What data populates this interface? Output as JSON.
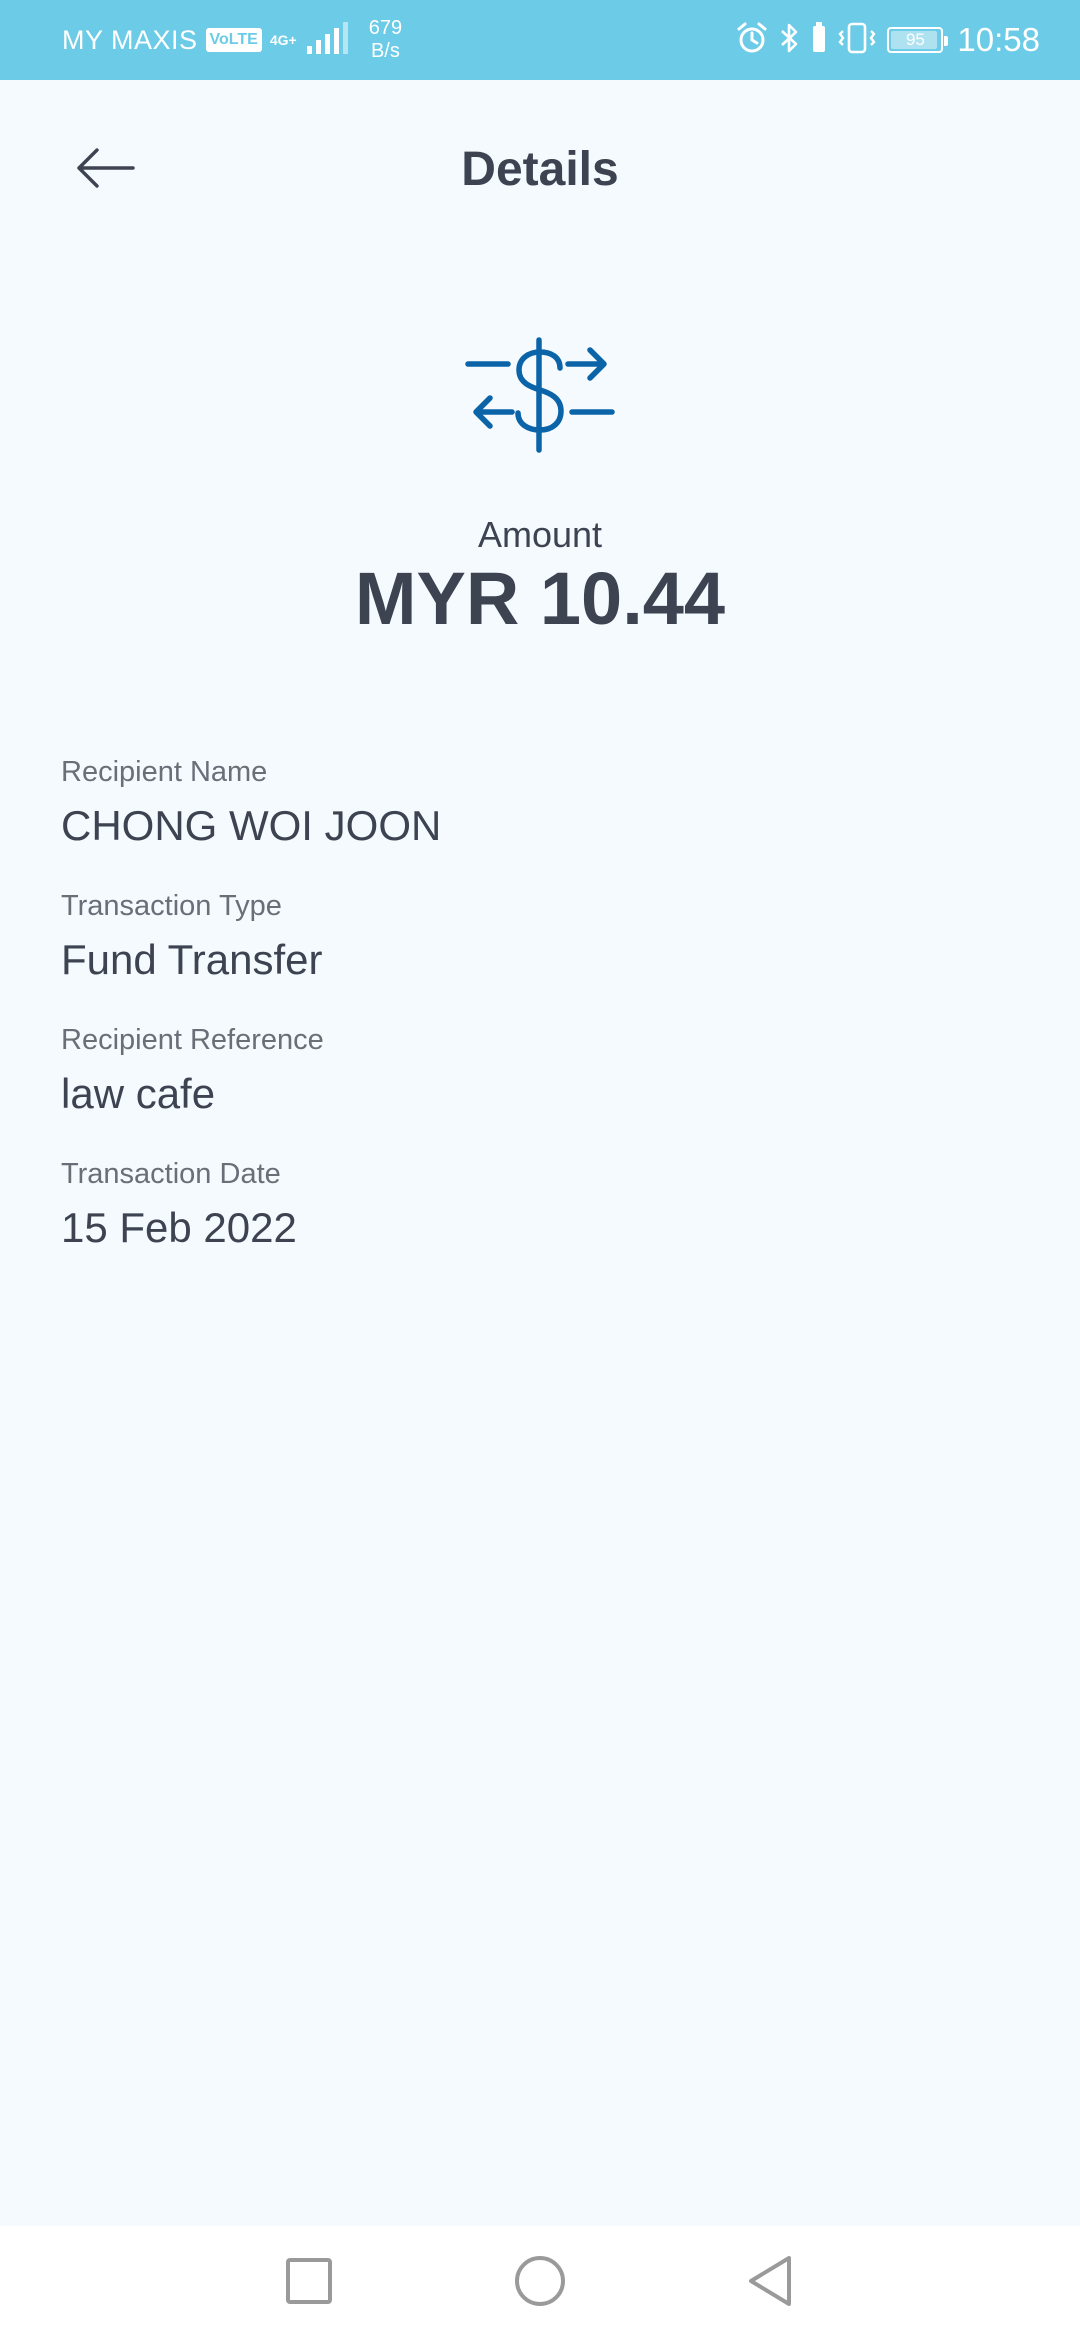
{
  "status_bar": {
    "carrier": "MY MAXIS",
    "volte": "VoLTE",
    "net_type": "4G+",
    "speed_value": "679",
    "speed_unit": "B/s",
    "battery_level": 95,
    "battery_text": "95",
    "time": "10:58"
  },
  "header": {
    "title": "Details"
  },
  "icons": {
    "back": "arrow-left-icon",
    "transfer": "money-transfer-icon",
    "alarm": "alarm-icon",
    "bluetooth": "bluetooth-icon",
    "vibrate": "vibrate-icon",
    "signal": "signal-icon",
    "nav_recent": "square-icon",
    "nav_home": "circle-icon",
    "nav_back": "triangle-back-icon"
  },
  "amount": {
    "label": "Amount",
    "value": "MYR 10.44"
  },
  "details": [
    {
      "label": "Recipient Name",
      "value": "CHONG WOI JOON"
    },
    {
      "label": "Transaction Type",
      "value": "Fund Transfer"
    },
    {
      "label": "Recipient Reference",
      "value": "law cafe"
    },
    {
      "label": "Transaction Date",
      "value": "15 Feb 2022"
    }
  ],
  "colors": {
    "status_bar": "#6ccbe6",
    "background": "#f4fafe",
    "icon_accent": "#0b64a8",
    "text_primary": "#3d4350",
    "text_secondary": "#6a6e77"
  }
}
